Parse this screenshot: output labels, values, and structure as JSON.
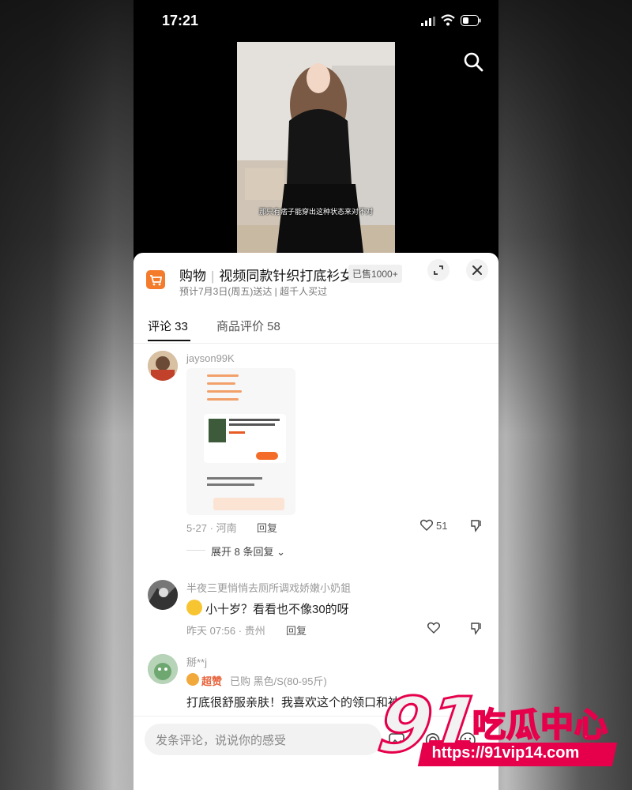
{
  "status_bar": {
    "time": "17:21"
  },
  "video": {
    "subtitle": "那只有痞子能穿出这种状态来对不对"
  },
  "product": {
    "category": "购物",
    "title": "视频同款针织打底衫女",
    "sold": "已售1000+",
    "delivery": "预计7月3日(周五)送达 | 超千人买过"
  },
  "tabs": [
    {
      "label": "评论 33",
      "active": true
    },
    {
      "label": "商品评价 58",
      "active": false
    }
  ],
  "comments": [
    {
      "user": "jayson99K",
      "has_image": true,
      "date": "5-27",
      "location": "河南",
      "reply_label": "回复",
      "likes": "51",
      "expand_label": "展开 8 条回复"
    },
    {
      "user": "半夜三更悄悄去厕所调戏娇嫩小奶鉏",
      "text": "小十岁？看看也不像30的呀",
      "date": "昨天 07:56",
      "location": "贵州",
      "reply_label": "回复"
    },
    {
      "user": "掰**j",
      "badge": "超赞",
      "purchase": "已购 黑色/S(80-95斤)",
      "text": "打底很舒服亲肤！我喜欢这个的领口和袖"
    }
  ],
  "input": {
    "placeholder": "发条评论，说说你的感受"
  },
  "watermark": {
    "number": "91",
    "name": "吃瓜中心",
    "url": "https://91vip14.com"
  },
  "colors": {
    "accent": "#f37b2b",
    "watermark": "#e6004c"
  }
}
